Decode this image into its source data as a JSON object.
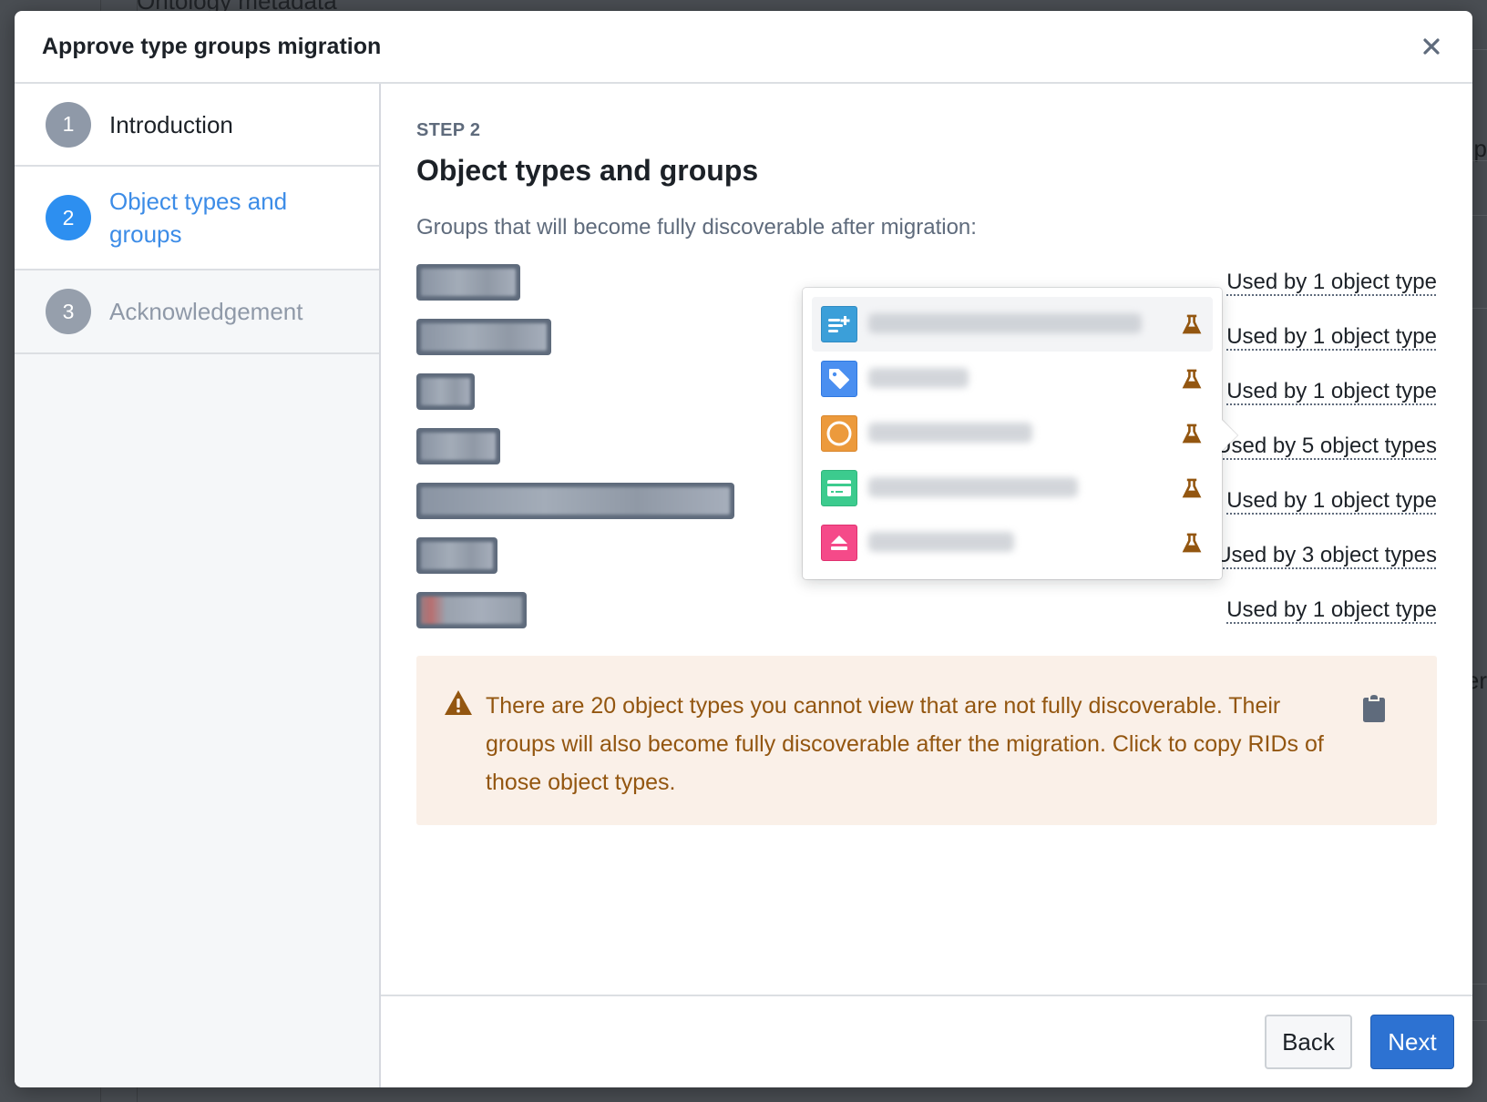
{
  "background": {
    "app_title": "Ontology metadata",
    "right_fragment_1": "p",
    "right_fragment_2": "er"
  },
  "dialog": {
    "title": "Approve type groups migration",
    "close_icon": "close-icon"
  },
  "stepper": {
    "steps": [
      {
        "number": "1",
        "label": "Introduction",
        "state": "completed"
      },
      {
        "number": "2",
        "label": "Object types and groups",
        "state": "active"
      },
      {
        "number": "3",
        "label": "Acknowledgement",
        "state": "upcoming"
      }
    ]
  },
  "content": {
    "kicker": "STEP 2",
    "title": "Object types and groups",
    "intro": "Groups that will become fully discoverable after migration:",
    "groups": [
      {
        "name": "[redacted]",
        "usage": "Used by 1 object type"
      },
      {
        "name": "[redacted]",
        "usage": "Used by 1 object type"
      },
      {
        "name": "[redacted]",
        "usage": "Used by 1 object type"
      },
      {
        "name": "[redacted]",
        "usage": "Used by 5 object types"
      },
      {
        "name": "[redacted]",
        "usage": "Used by 1 object type"
      },
      {
        "name": "[redacted]",
        "usage": "Used by 3 object types"
      },
      {
        "name": "[redacted]",
        "usage": "Used by 1 object type"
      }
    ],
    "popover": {
      "for_group_index": 3,
      "items": [
        {
          "name": "[redacted]",
          "icon": "list-add-icon",
          "color": "#3b9fd9",
          "status_icon": "experimental-flask-icon"
        },
        {
          "name": "[redacted]",
          "icon": "tag-icon",
          "color": "#4a8ff0",
          "status_icon": "experimental-flask-icon"
        },
        {
          "name": "[redacted]",
          "icon": "circle-icon",
          "color": "#ec9a3c",
          "status_icon": "experimental-flask-icon"
        },
        {
          "name": "[redacted]",
          "icon": "credit-card-icon",
          "color": "#3ccb8e",
          "status_icon": "experimental-flask-icon"
        },
        {
          "name": "[redacted]",
          "icon": "eject-icon",
          "color": "#f54a89",
          "status_icon": "experimental-flask-icon"
        }
      ]
    },
    "warning": {
      "text": "There are 20 object types you cannot view that are not fully discoverable. Their groups will also become fully discoverable after the migration. Click to copy RIDs of those object types.",
      "icon": "warning-sign-icon",
      "copy_icon": "clipboard-icon"
    }
  },
  "footer": {
    "back_label": "Back",
    "next_label": "Next"
  },
  "colors": {
    "accent": "#2d72d2",
    "active_step": "#3c8ce7",
    "warning_text": "#935610",
    "warning_bg": "#faf0e8",
    "experimental_flask": "#935610"
  }
}
